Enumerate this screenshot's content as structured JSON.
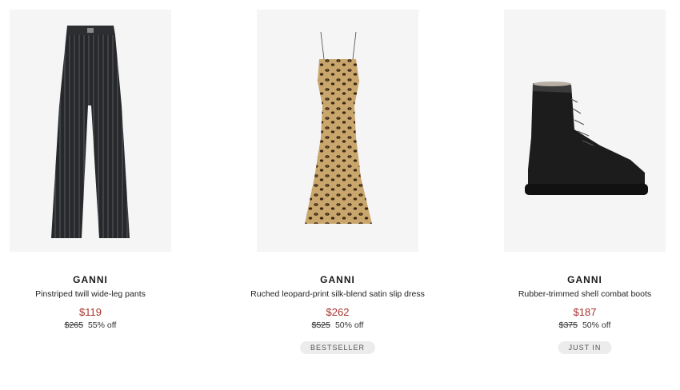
{
  "products": [
    {
      "brand": "GANNI",
      "name": "Pinstriped twill wide-leg pants",
      "price": "$119",
      "original_price": "$265",
      "discount": "55% off",
      "badge": "",
      "image_icon": "pinstriped-pants-image"
    },
    {
      "brand": "GANNI",
      "name": "Ruched leopard-print silk-blend satin slip dress",
      "price": "$262",
      "original_price": "$525",
      "discount": "50% off",
      "badge": "BESTSELLER",
      "image_icon": "leopard-slip-dress-image"
    },
    {
      "brand": "GANNI",
      "name": "Rubber-trimmed shell combat boots",
      "price": "$187",
      "original_price": "$375",
      "discount": "50% off",
      "badge": "JUST IN",
      "image_icon": "combat-boots-image"
    }
  ],
  "colors": {
    "sale_price": "#a6302b",
    "image_background": "#f5f5f5",
    "badge_background": "#ececec"
  }
}
